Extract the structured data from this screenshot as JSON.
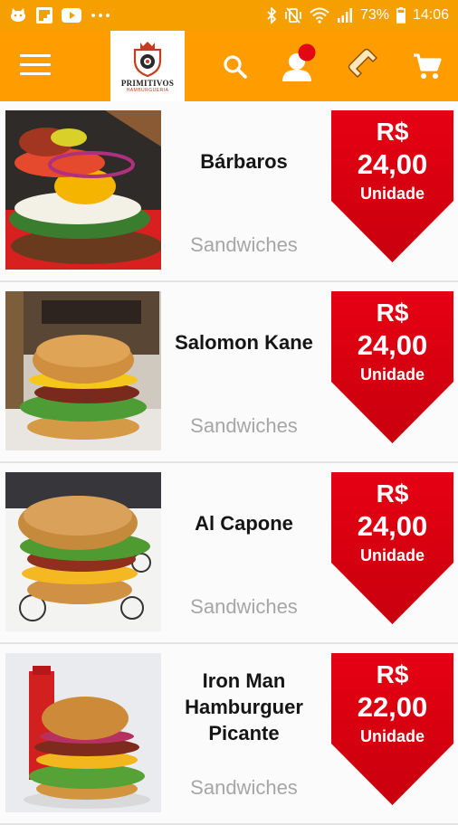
{
  "status_bar": {
    "battery": "73%",
    "time": "14:06",
    "notif_icons": [
      "cat-icon",
      "flipboard-icon",
      "youtube-icon",
      "more-dots-icon"
    ],
    "system_icons": [
      "bluetooth-icon",
      "vibrate-icon",
      "wifi-icon",
      "signal-icon",
      "battery-icon"
    ]
  },
  "app_bar": {
    "logo_text": "PRIMITIVOS",
    "logo_sub": "HAMBURGUERIA",
    "background": "#ff9d00"
  },
  "products": [
    {
      "name": "Bárbaros",
      "category": "Sandwiches",
      "currency": "R$",
      "price": "24,00",
      "unit": "Unidade"
    },
    {
      "name": "Salomon Kane",
      "category": "Sandwiches",
      "currency": "R$",
      "price": "24,00",
      "unit": "Unidade"
    },
    {
      "name": "Al Capone",
      "category": "Sandwiches",
      "currency": "R$",
      "price": "24,00",
      "unit": "Unidade"
    },
    {
      "name": "Iron Man Hamburguer Picante",
      "category": "Sandwiches",
      "currency": "R$",
      "price": "22,00",
      "unit": "Unidade"
    }
  ],
  "colors": {
    "accent": "#ff9d00",
    "price_tag": "#e10012",
    "category_text": "#a6a6a6"
  }
}
